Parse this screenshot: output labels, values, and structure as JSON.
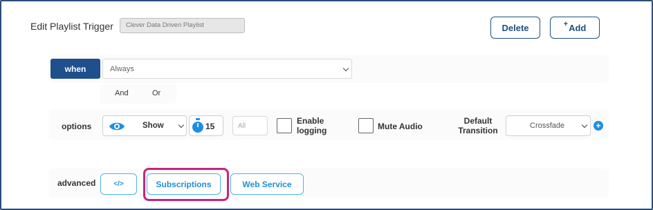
{
  "header": {
    "title": "Edit Playlist Trigger",
    "playlist_name": "Clever Data Driven Playlist",
    "delete_label": "Delete",
    "add_plus": "+",
    "add_label": "Add"
  },
  "when": {
    "button_label": "when",
    "selected": "Always",
    "and_label": "And",
    "or_label": "Or"
  },
  "options": {
    "label": "options",
    "show_selected": "Show",
    "duration": "15",
    "all_placeholder": "All",
    "enable_logging_label": "Enable\nlogging",
    "enable_logging_line1": "Enable",
    "enable_logging_line2": "logging",
    "enable_logging_checked": false,
    "mute_audio_label": "Mute Audio",
    "mute_audio_checked": false,
    "transition_line1": "Default",
    "transition_line2": "Transition",
    "transition_selected": "Crossfade",
    "add_symbol": "+"
  },
  "advanced": {
    "label": "advanced",
    "code_label": "</>",
    "subscriptions_label": "Subscriptions",
    "web_service_label": "Web Service"
  },
  "colors": {
    "frame": "#2a4d7a",
    "primary": "#1f4f8c",
    "accent": "#1e8fe0",
    "highlight": "#c8247a"
  },
  "icons": {
    "eye": "eye-icon",
    "timer": "stopwatch-icon",
    "add": "plus-circle-icon"
  }
}
